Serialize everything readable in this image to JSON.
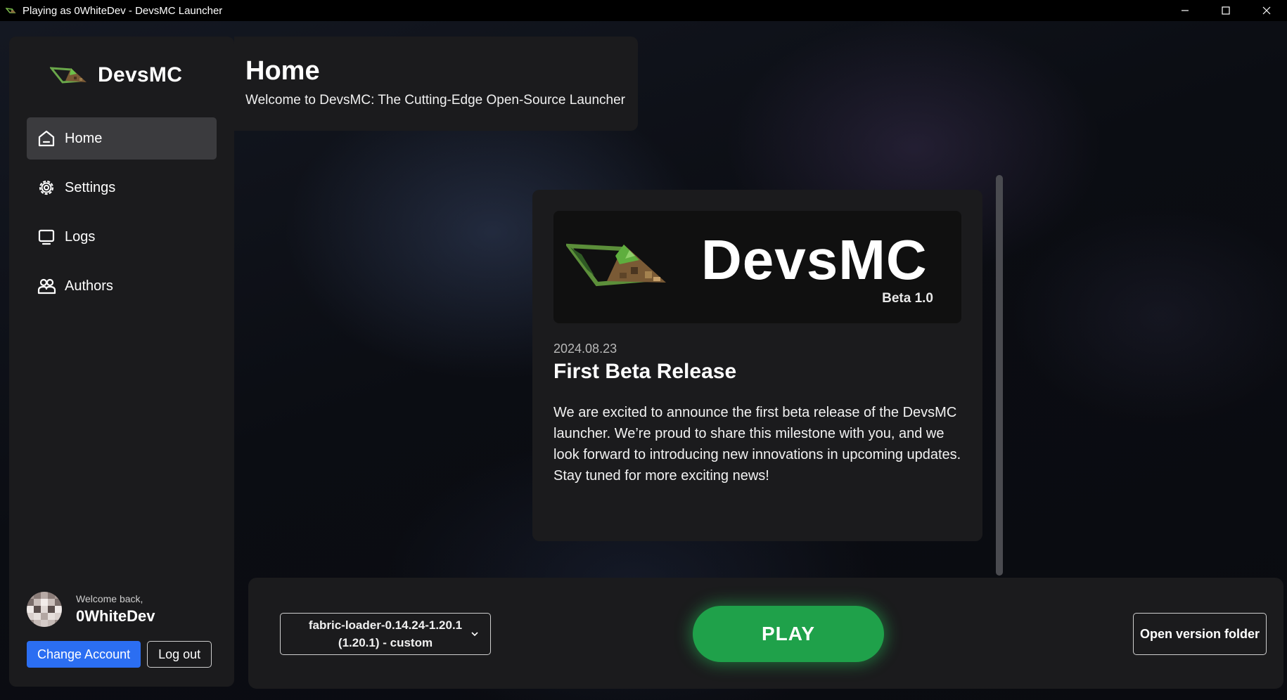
{
  "window": {
    "title": "Playing as 0WhiteDev - DevsMC Launcher",
    "controls": [
      "minimize-icon",
      "maximize-icon",
      "close-icon"
    ]
  },
  "sidebar": {
    "brand": "DevsMC",
    "items": [
      {
        "label": "Home",
        "icon": "home-icon",
        "active": true
      },
      {
        "label": "Settings",
        "icon": "gear-icon",
        "active": false
      },
      {
        "label": "Logs",
        "icon": "monitor-icon",
        "active": false
      },
      {
        "label": "Authors",
        "icon": "users-icon",
        "active": false
      }
    ],
    "user": {
      "welcome": "Welcome back,",
      "name": "0WhiteDev",
      "change_account": "Change Account",
      "logout": "Log out"
    }
  },
  "header": {
    "title": "Home",
    "subtitle": "Welcome to DevsMC: The Cutting-Edge Open-Source Launcher"
  },
  "news": {
    "banner_title": "DevsMC",
    "banner_version": "Beta 1.0",
    "date": "2024.08.23",
    "title": "First Beta Release",
    "body": "We are excited to announce the first beta release of the DevsMC launcher. We’re proud to share this milestone with you, and we look forward to introducing new innovations in upcoming updates. Stay tuned for more exciting news!"
  },
  "bottom": {
    "version_line1": "fabric-loader-0.14.24-1.20.1",
    "version_line2": "(1.20.1) - custom",
    "play": "PLAY",
    "open_folder": "Open version folder"
  },
  "colors": {
    "accent_blue": "#2b6ef2",
    "play_green": "#1fa14a",
    "panel": "#1b1b1d",
    "active_nav": "#3b3b3e"
  }
}
